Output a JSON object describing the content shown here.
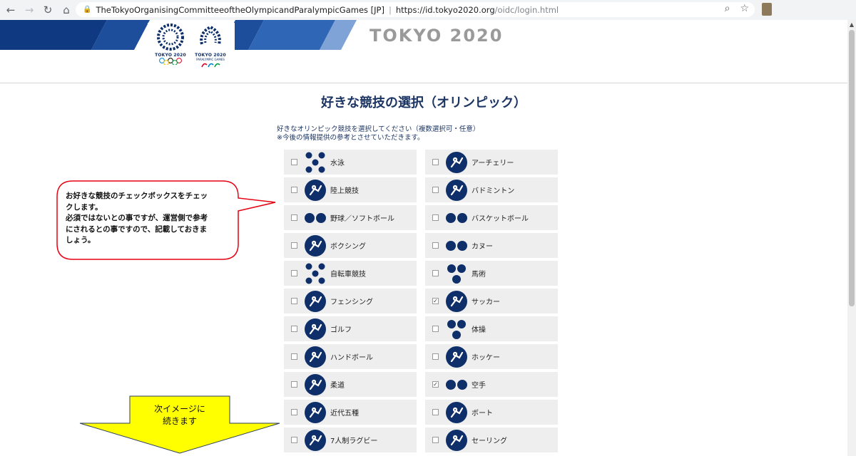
{
  "browser": {
    "org_name": "TheTokyoOrganisingCommitteeoftheOlympicandParalympicGames [JP]",
    "url_host": "https://id.tokyo2020.org",
    "url_path": "/oidc/login.html",
    "back_icon": "arrow-left-icon",
    "forward_icon": "arrow-right-icon",
    "reload_icon": "reload-icon",
    "home_icon": "home-icon"
  },
  "header": {
    "brand": "TOKYO 2020",
    "olympic_logo_text": "TOKYO 2020",
    "paralympic_logo_text": "TOKYO 2020",
    "paralympic_logo_sub": "PARALYMPIC GAMES",
    "brand_color": "#0e2f6a"
  },
  "page": {
    "title": "好きな競技の選択（オリンピック）",
    "instruction_line1": "好きなオリンピック競技を選択してください（複数選択可・任意）",
    "instruction_line2": "※今後の情報提供の参考とさせていただきます。"
  },
  "sports": [
    {
      "label": "水泳",
      "checked": false,
      "icon": "multi"
    },
    {
      "label": "アーチェリー",
      "checked": false,
      "icon": "single"
    },
    {
      "label": "陸上競技",
      "checked": false,
      "icon": "single"
    },
    {
      "label": "バドミントン",
      "checked": false,
      "icon": "single"
    },
    {
      "label": "野球／ソフトボール",
      "checked": false,
      "icon": "double"
    },
    {
      "label": "バスケットボール",
      "checked": false,
      "icon": "double"
    },
    {
      "label": "ボクシング",
      "checked": false,
      "icon": "single"
    },
    {
      "label": "カヌー",
      "checked": false,
      "icon": "double"
    },
    {
      "label": "自転車競技",
      "checked": false,
      "icon": "multi"
    },
    {
      "label": "馬術",
      "checked": false,
      "icon": "triple"
    },
    {
      "label": "フェンシング",
      "checked": false,
      "icon": "single"
    },
    {
      "label": "サッカー",
      "checked": true,
      "icon": "single"
    },
    {
      "label": "ゴルフ",
      "checked": false,
      "icon": "single"
    },
    {
      "label": "体操",
      "checked": false,
      "icon": "triple"
    },
    {
      "label": "ハンドボール",
      "checked": false,
      "icon": "single"
    },
    {
      "label": "ホッケー",
      "checked": false,
      "icon": "single"
    },
    {
      "label": "柔道",
      "checked": false,
      "icon": "single"
    },
    {
      "label": "空手",
      "checked": true,
      "icon": "double"
    },
    {
      "label": "近代五種",
      "checked": false,
      "icon": "single"
    },
    {
      "label": "ボート",
      "checked": false,
      "icon": "single"
    },
    {
      "label": "7人制ラグビー",
      "checked": false,
      "icon": "single"
    },
    {
      "label": "セーリング",
      "checked": false,
      "icon": "single"
    }
  ],
  "callout": {
    "text_lines": [
      "お好きな競技のチェックボックスをチェッ",
      "クします。",
      "必須ではないとの事ですが、運営側で参考",
      "にされるとの事ですので、記載しておきま",
      "しょう。"
    ],
    "border_color": "#e60012"
  },
  "arrow": {
    "line1": "次イメージに",
    "line2": "続きます",
    "fill_color": "#ffff00"
  }
}
